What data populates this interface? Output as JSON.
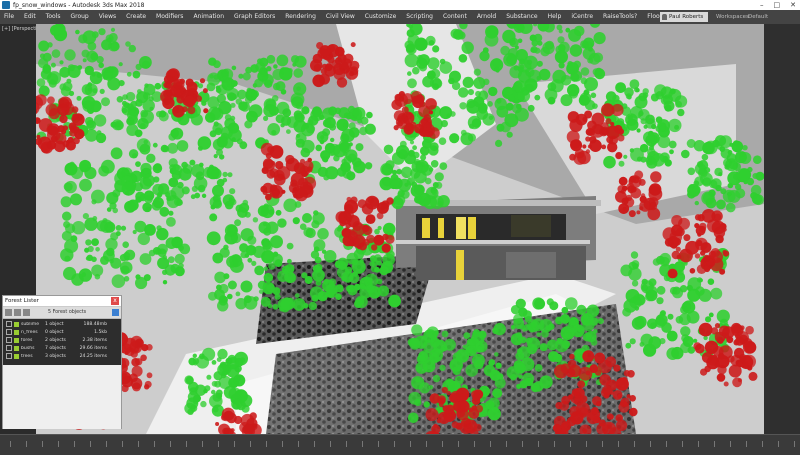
{
  "window": {
    "title": "fp_snow_windows - Autodesk 3ds Max 2018",
    "controls": [
      "–",
      "□",
      "✕"
    ]
  },
  "menu": [
    "File",
    "Edit",
    "Tools",
    "Group",
    "Views",
    "Create",
    "Modifiers",
    "Animation",
    "Graph Editors",
    "Rendering",
    "Civil View",
    "Customize",
    "Scripting",
    "Content",
    "Arnold",
    "Substance",
    "Help",
    "iCentre",
    "RaiseTools?",
    "Flood"
  ],
  "user": {
    "name": "Paul Roberts"
  },
  "right_menu": {
    "workspaces": "Workspaces:",
    "default": "Default"
  },
  "viewport": {
    "label": "[+] [Perspective]"
  },
  "forest_editor": {
    "title": "Forest Lister",
    "close": "x",
    "object_count": "5 Forest objects",
    "rows": [
      {
        "name": "sublime",
        "objects": "1 object",
        "memory": "188.48mb"
      },
      {
        "name": "n_frees",
        "objects": "0 object",
        "memory": "1.5kb"
      },
      {
        "name": "fores",
        "objects": "2 objects",
        "memory": "2.38 items"
      },
      {
        "name": "bushs",
        "objects": "7 objects",
        "memory": "29.66 items"
      },
      {
        "name": "trees",
        "objects": "3 objects",
        "memory": "24.25 items"
      }
    ]
  },
  "colors": {
    "green_tree": "#2fcf2f",
    "red_tree": "#cc1a1a",
    "snow": "#cfcfcf",
    "window_glow": "#e8d23a"
  },
  "icons": [
    "app-icon",
    "user-icon",
    "close-icon"
  ]
}
